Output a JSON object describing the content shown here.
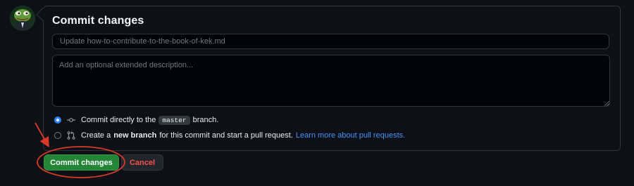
{
  "header": {
    "title": "Commit changes"
  },
  "form": {
    "summary_placeholder": "Update how-to-contribute-to-the-book-of-kek.md",
    "description_placeholder": "Add an optional extended description..."
  },
  "options": {
    "direct": {
      "prefix": "Commit directly to the",
      "branch": "master",
      "suffix": "branch.",
      "selected": true
    },
    "new_branch": {
      "prefix": "Create a",
      "bold": "new branch",
      "suffix": "for this commit and start a pull request.",
      "link": "Learn more about pull requests.",
      "selected": false
    }
  },
  "actions": {
    "commit_label": "Commit changes",
    "cancel_label": "Cancel"
  },
  "colors": {
    "primary": "#238636",
    "danger": "#f85149",
    "link": "#4493f8",
    "annotation": "#d93a26"
  },
  "icons": {
    "direct": "git-commit-icon",
    "new_branch": "git-pull-request-icon"
  }
}
